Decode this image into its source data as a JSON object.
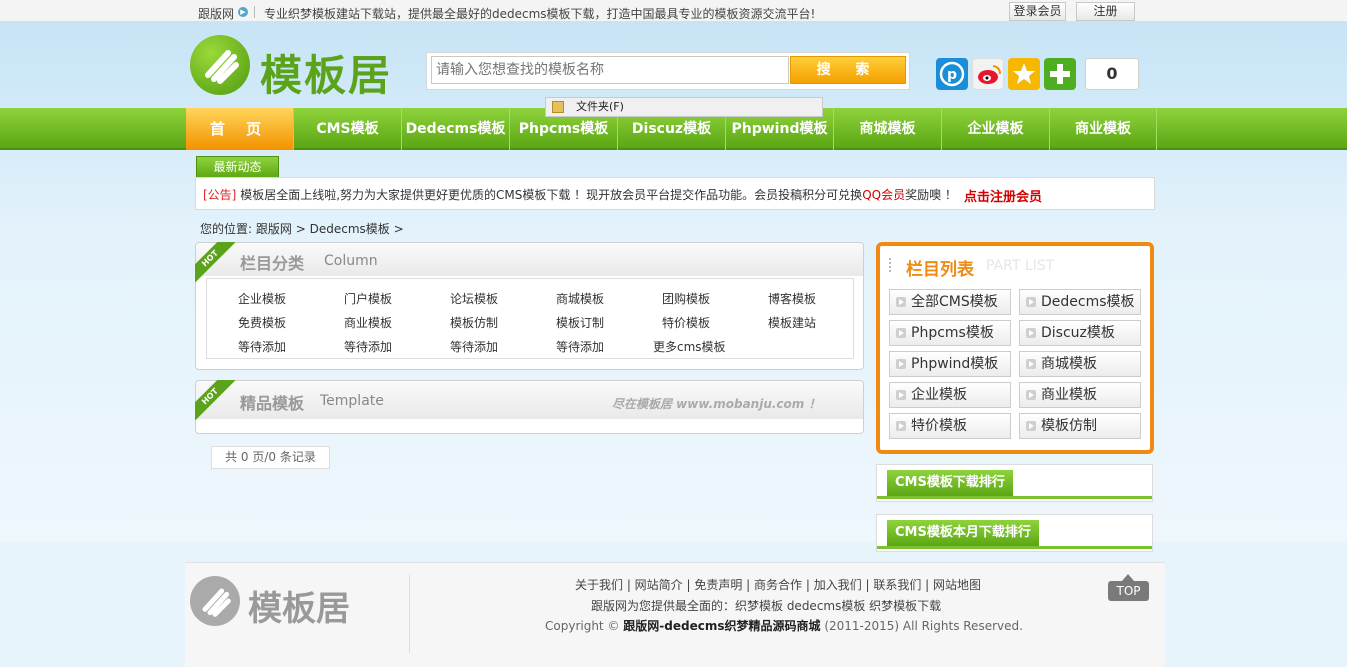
{
  "topbar": {
    "site_name": "跟版网",
    "slogan": "专业织梦模板建站下载站，提供最全最好的dedecms模板下载，打造中国最具专业的模板资源交流平台!",
    "login_label": "登录会员",
    "register_label": "注册"
  },
  "header": {
    "logo_text": "模板居",
    "search": {
      "placeholder": "请输入您想查找的模板名称",
      "value": "",
      "button_label": "搜 索"
    },
    "share_count": "0",
    "popup_folder_label": "文件夹(F)"
  },
  "nav": {
    "items": [
      "首 页",
      "CMS模板",
      "Dedecms模板",
      "Phpcms模板",
      "Discuz模板",
      "Phpwind模板",
      "商城模板",
      "企业模板",
      "商业模板"
    ]
  },
  "news": {
    "tab_label": "最新动态",
    "tag": "[公告]",
    "text_main": "模板居全面上线啦,努力为大家提供更好更优质的CMS模板下载 ！现开放会员平台提交作品功能。会员投稿积分可兑换",
    "text_highlight": "QQ会员",
    "text_end": "奖励噢 ！",
    "register_link": "点击注册会员"
  },
  "breadcrumb": {
    "label": "您的位置:",
    "items": [
      "跟版网",
      "Dedecms模板"
    ]
  },
  "column_box": {
    "hot_badge": "HOT",
    "title": "栏目分类",
    "title_en": "Column",
    "categories": [
      [
        "企业模板",
        "门户模板",
        "论坛模板",
        "商城模板",
        "团购模板",
        "博客模板"
      ],
      [
        "免费模板",
        "商业模板",
        "模板仿制",
        "模板订制",
        "特价模板",
        "模板建站"
      ],
      [
        "等待添加",
        "等待添加",
        "等待添加",
        "等待添加",
        "更多cms模板"
      ]
    ]
  },
  "template_box": {
    "hot_badge": "HOT",
    "title": "精品模板",
    "title_en": "Template",
    "ad_text": "尽在模板居  www.mobanju.com ！"
  },
  "pager": {
    "text": "共 0 页/0 条记录"
  },
  "part_list": {
    "title": "栏目列表",
    "title_en": "PART LIST",
    "items": [
      "全部CMS模板",
      "Dedecms模板",
      "Phpcms模板",
      "Discuz模板",
      "Phpwind模板",
      "商城模板",
      "企业模板",
      "商业模板",
      "特价模板",
      "模板仿制"
    ]
  },
  "rankings": {
    "week_title": "CMS模板下载排行",
    "month_title": "CMS模板本月下载排行"
  },
  "footer": {
    "logo_text": "模板居",
    "links": "关于我们 | 网站简介 | 免责声明 | 商务合作 | 加入我们 | 联系我们 | 网站地图",
    "line2": "跟版网为您提供最全面的：织梦模板  dedecms模板  织梦模板下载",
    "copyright_prefix": "Copyright ©",
    "copyright_name": "跟版网-dedecms织梦精品源码商城",
    "copyright_suffix": "(2011-2015) All Rights Reserved.",
    "top_label": "TOP"
  },
  "colors": {
    "brand_green": "#5aa31a",
    "accent_orange": "#f08a10",
    "nav_home": "#f39200"
  }
}
